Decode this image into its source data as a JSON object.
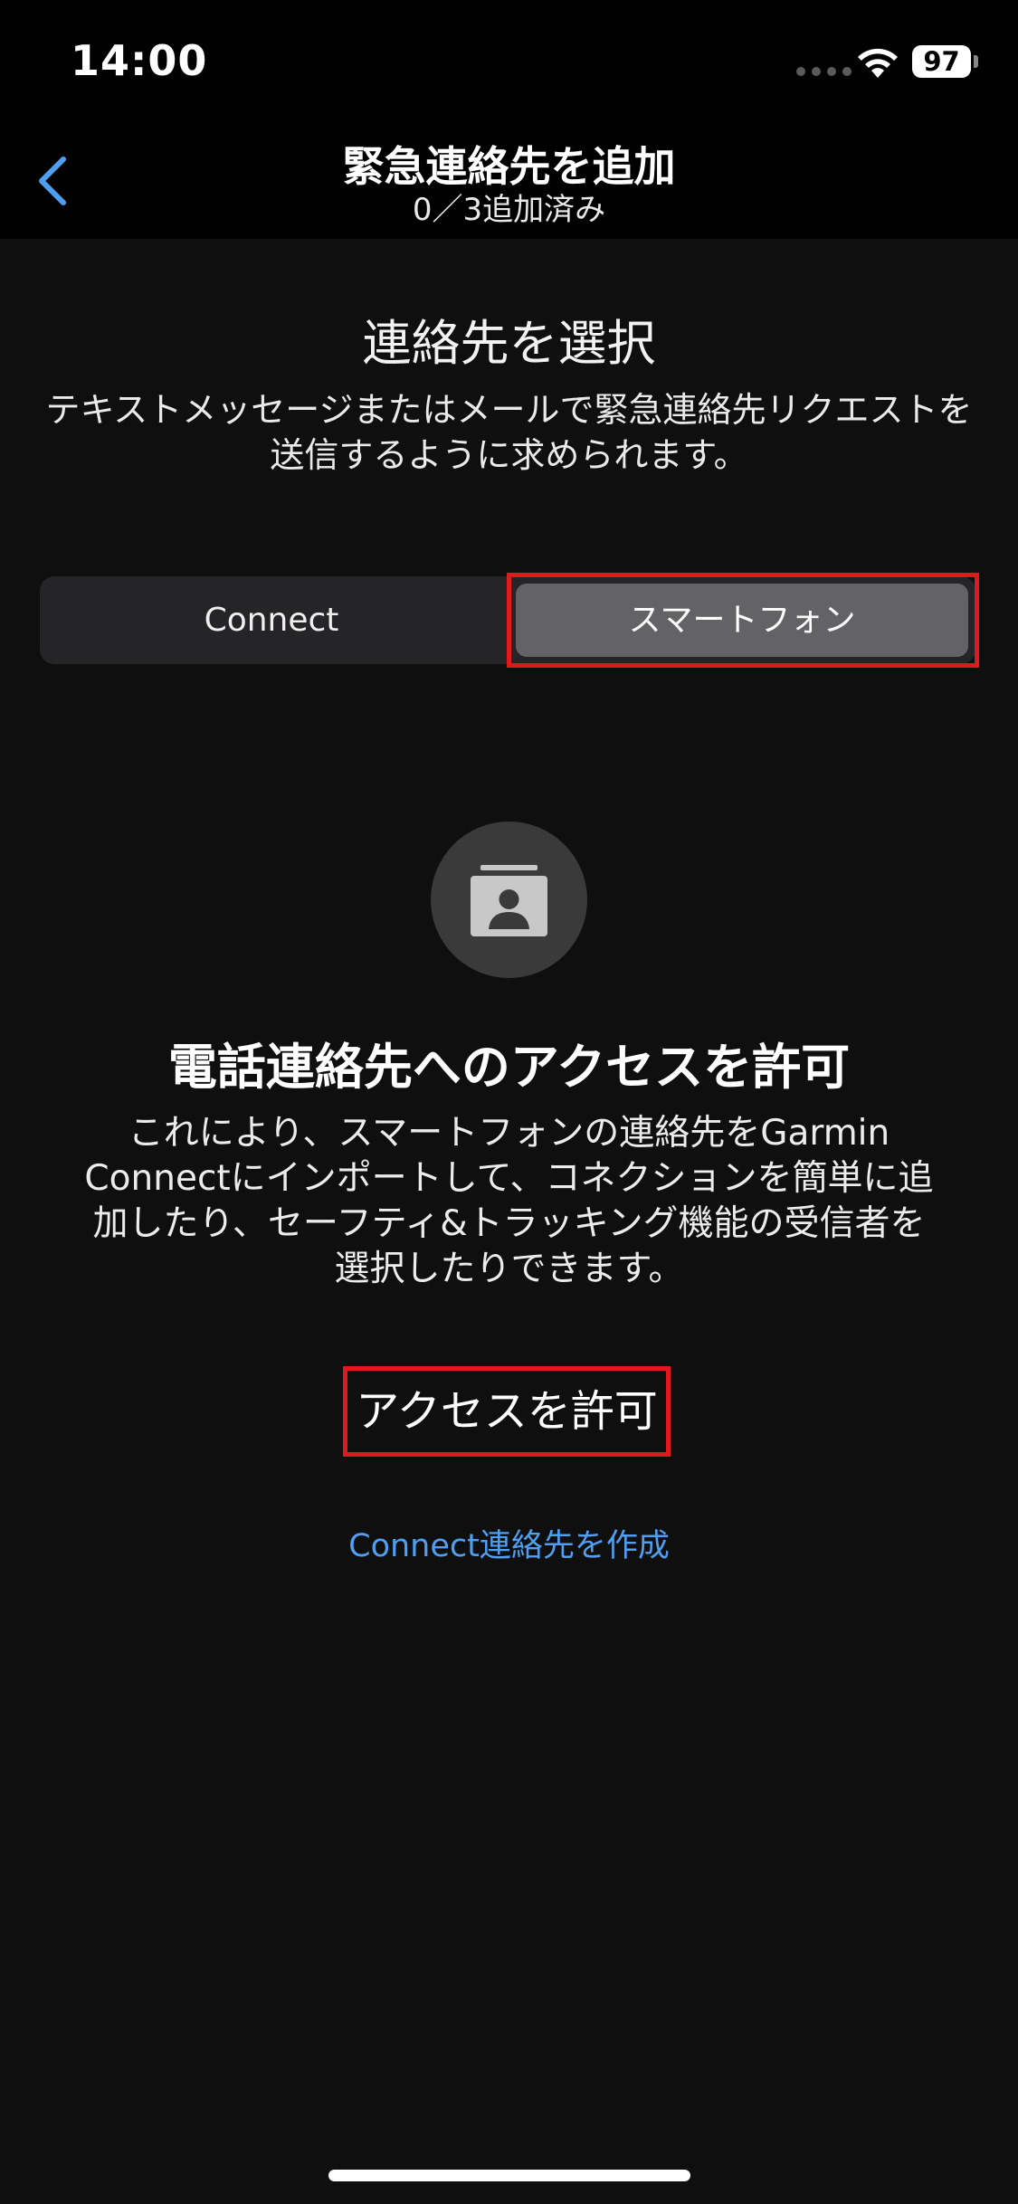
{
  "status_bar": {
    "time": "14:00",
    "battery": "97",
    "icons": [
      "signal-dots-icon",
      "wifi-icon",
      "battery-icon"
    ]
  },
  "nav": {
    "back_icon": "chevron-left-icon",
    "title": "緊急連絡先を追加",
    "subtitle": "0／3追加済み"
  },
  "section": {
    "title": "連絡先を選択",
    "description": "テキストメッセージまたはメールで緊急連絡先リクエストを送信するように求められます。"
  },
  "segmented_control": {
    "options": [
      "Connect",
      "スマートフォン"
    ],
    "selected": "スマートフォン"
  },
  "permission": {
    "icon": "contact-card-icon",
    "title": "電話連絡先へのアクセスを許可",
    "description": "これにより、スマートフォンの連絡先をGarmin Connectにインポートして、コネクションを簡単に追加したり、セーフティ&トラッキング機能の受信者を選択したりできます。",
    "allow_button": "アクセスを許可",
    "create_link": "Connect連絡先を作成"
  },
  "colors": {
    "background": "#0f0f0f",
    "accent_blue": "#4f9ef0",
    "highlight_red": "#e0191f",
    "segment_selected": "#636366"
  }
}
